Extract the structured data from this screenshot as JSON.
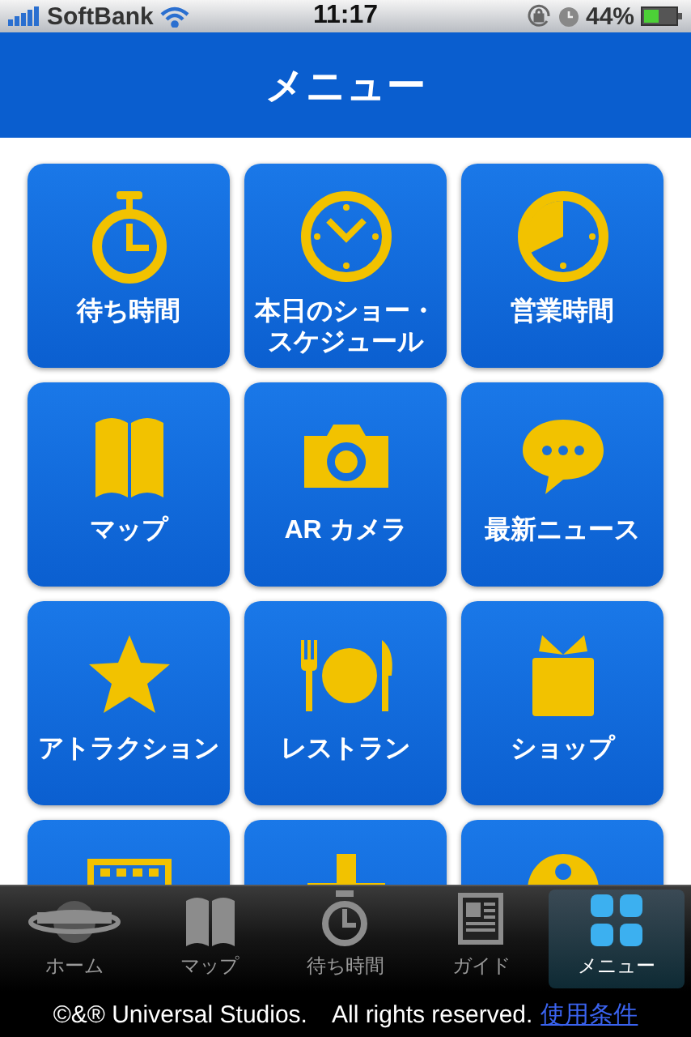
{
  "status_bar": {
    "carrier": "SoftBank",
    "time": "11:17",
    "battery": "44%"
  },
  "header": {
    "title": "メニュー"
  },
  "tiles": [
    {
      "kind": "stopwatch",
      "label": "待ち時間"
    },
    {
      "kind": "clock",
      "label": "本日のショー・スケジュール"
    },
    {
      "kind": "pieclock",
      "label": "営業時間"
    },
    {
      "kind": "map",
      "label": "マップ"
    },
    {
      "kind": "camera",
      "label": "AR カメラ"
    },
    {
      "kind": "bubble",
      "label": "最新ニュース"
    },
    {
      "kind": "star",
      "label": "アトラクション"
    },
    {
      "kind": "dining",
      "label": "レストラン"
    },
    {
      "kind": "gift",
      "label": "ショップ"
    },
    {
      "kind": "film"
    },
    {
      "kind": "plus"
    },
    {
      "kind": "pin"
    }
  ],
  "tab_bar": [
    {
      "kind": "logo",
      "label": "ホーム",
      "selected": false
    },
    {
      "kind": "map",
      "label": "マップ",
      "selected": false
    },
    {
      "kind": "stopwatch",
      "label": "待ち時間",
      "selected": false
    },
    {
      "kind": "guide",
      "label": "ガイド",
      "selected": false
    },
    {
      "kind": "grid",
      "label": "メニュー",
      "selected": true
    }
  ],
  "footer": {
    "copyright": "©&® Universal Studios.　All rights reserved.",
    "link": "使用条件"
  }
}
